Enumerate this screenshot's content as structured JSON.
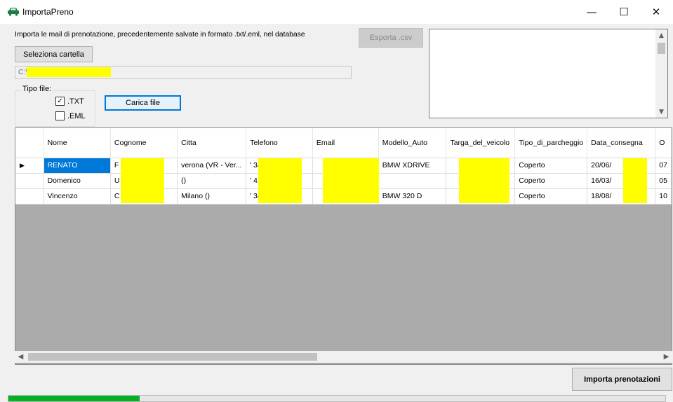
{
  "window": {
    "title": "ImportaPreno",
    "minimize": "—",
    "maximize": "☐",
    "close": "✕"
  },
  "form": {
    "description": "Importa le mail di prenotazione, precedentemente salvate in formato .txt/.eml, nel database",
    "select_folder_label": "Seleziona cartella",
    "export_label": "Esporta .csv",
    "path_value": "C:\\",
    "file_type_label": "Tipo file:",
    "checkbox_txt_label": ".TXT",
    "checkbox_txt_checked": true,
    "checkbox_eml_label": ".EML",
    "checkbox_eml_checked": false,
    "load_label": "Carica file",
    "import_label": "Importa prenotazioni",
    "progress_fraction": 0.2
  },
  "grid": {
    "columns": [
      "Nome",
      "Cognome",
      "Citta",
      "Telefono",
      "Email",
      "Modello_Auto",
      "Targa_del_veicolo",
      "Tipo_di_parcheggio",
      "Data_consegna",
      "O"
    ],
    "rows": [
      {
        "marker": "▶",
        "cells": [
          "RENATO",
          "F",
          "verona (VR - Ver...",
          "' 348",
          "",
          "BMW XDRIVE",
          "",
          "Coperto",
          "20/06/",
          "07"
        ]
      },
      {
        "marker": "",
        "cells": [
          "Domenico",
          "U",
          "()",
          "' 417",
          "",
          "",
          "",
          "Coperto",
          "16/03/",
          "05"
        ]
      },
      {
        "marker": "",
        "cells": [
          "Vincenzo",
          "C",
          "Milano ()",
          "' 349",
          "",
          "BMW 320 D",
          "",
          "Coperto",
          "18/08/",
          "10"
        ]
      }
    ]
  },
  "colors": {
    "selection": "#0078d7",
    "progress": "#06b025",
    "mask": "#ffff00"
  },
  "icons": {
    "app": "car-icon",
    "scroll_up": "chevron-up-icon",
    "scroll_down": "chevron-down-icon",
    "scroll_left": "chevron-left-icon",
    "scroll_right": "chevron-right-icon"
  }
}
